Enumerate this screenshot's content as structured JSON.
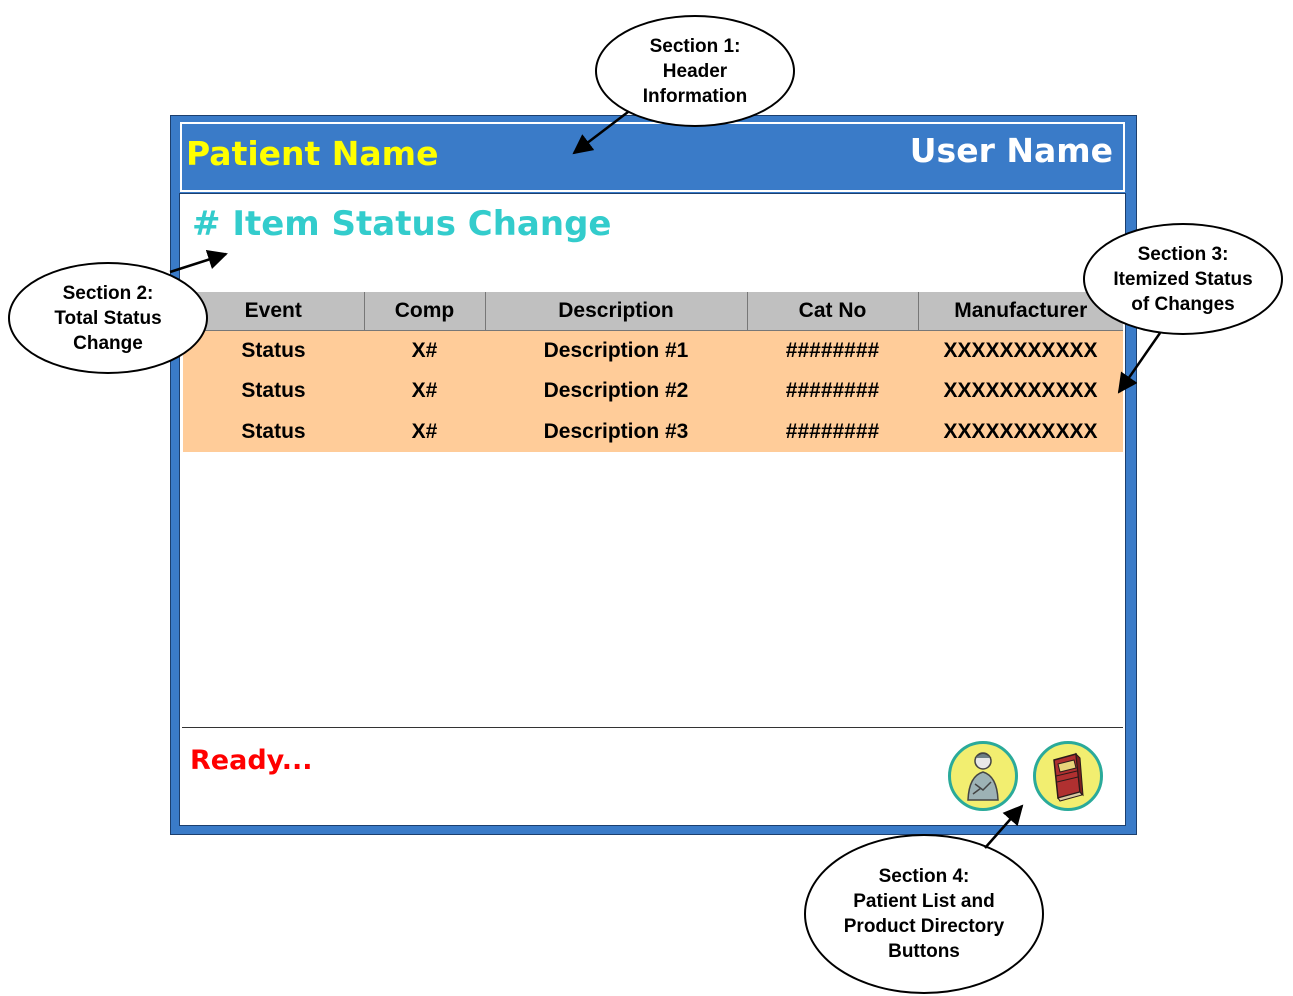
{
  "header": {
    "patient_name": "Patient Name",
    "user_name": "User Name"
  },
  "main": {
    "title": "# Item Status Change",
    "table": {
      "columns": [
        "Event",
        "Comp",
        "Description",
        "Cat No",
        "Manufacturer"
      ],
      "rows": [
        [
          "Status",
          "X#",
          "Description #1",
          "########",
          "XXXXXXXXXXX"
        ],
        [
          "Status",
          "X#",
          "Description #2",
          "########",
          "XXXXXXXXXXX"
        ],
        [
          "Status",
          "X#",
          "Description #3",
          "########",
          "XXXXXXXXXXX"
        ]
      ]
    }
  },
  "status_bar": {
    "text": "Ready..."
  },
  "buttons": [
    {
      "icon": "patient-list-icon"
    },
    {
      "icon": "product-directory-icon"
    }
  ],
  "callouts": {
    "section1": "Section 1:\nHeader\nInformation",
    "section2": "Section 2:\nTotal Status\nChange",
    "section3": "Section 3:\nItemized Status\nof Changes",
    "section4": "Section 4:\nPatient List and\nProduct Directory\nButtons"
  },
  "colors": {
    "frame": "#3a7bc8",
    "patient_name": "#ffff00",
    "title": "#33cccc",
    "row_background": "#ffcc99",
    "header_background": "#c0c0c0",
    "ready": "#ff0000"
  }
}
